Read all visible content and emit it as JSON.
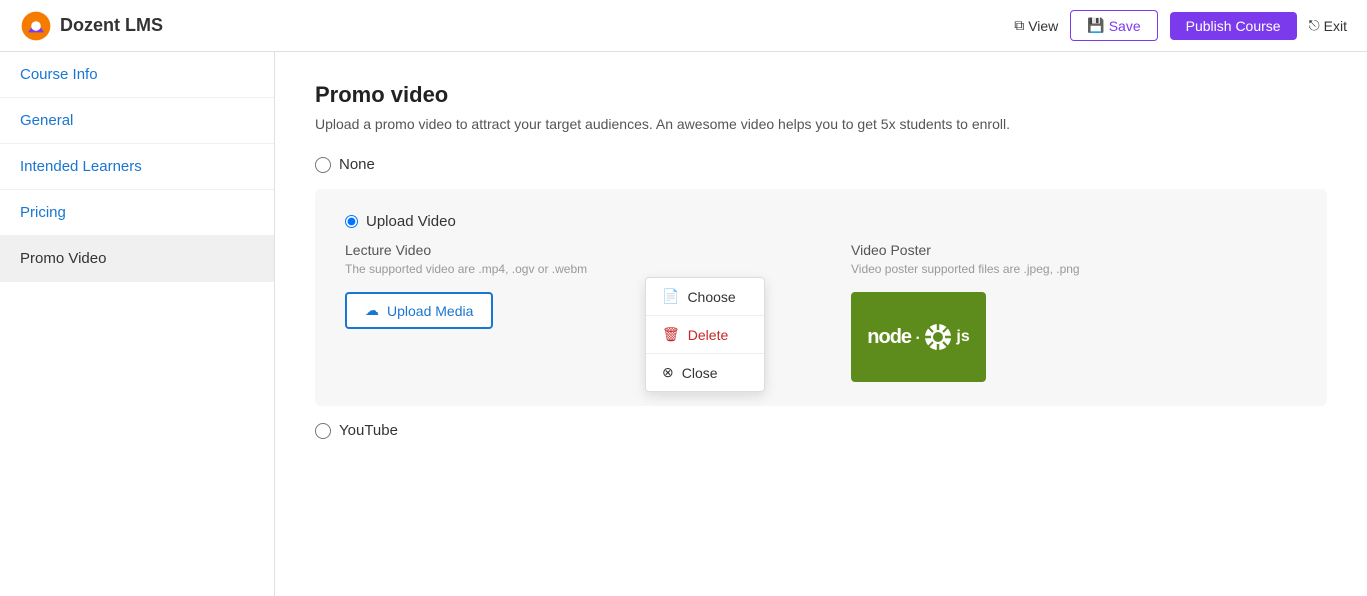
{
  "app": {
    "name": "Dozent LMS"
  },
  "header": {
    "view_label": "View",
    "save_label": "Save",
    "publish_label": "Publish Course",
    "exit_label": "Exit"
  },
  "sidebar": {
    "items": [
      {
        "label": "Course Info",
        "id": "course-info",
        "active": false
      },
      {
        "label": "General",
        "id": "general",
        "active": false
      },
      {
        "label": "Intended Learners",
        "id": "intended-learners",
        "active": false
      },
      {
        "label": "Pricing",
        "id": "pricing",
        "active": false
      },
      {
        "label": "Promo Video",
        "id": "promo-video",
        "active": true
      }
    ]
  },
  "main": {
    "title": "Promo video",
    "subtitle": "Upload a promo video to attract your target audiences. An awesome video helps you to get 5x students to enroll.",
    "options": {
      "none_label": "None",
      "upload_video_label": "Upload Video",
      "youtube_label": "YouTube"
    },
    "lecture_video": {
      "title": "Lecture Video",
      "subtitle": "The supported video are .mp4, .ogv or .webm",
      "upload_button_label": "Upload Media"
    },
    "video_poster": {
      "title": "Video Poster",
      "subtitle": "Video poster supported files are .jpeg, .png"
    },
    "dropdown": {
      "choose_label": "Choose",
      "delete_label": "Delete",
      "close_label": "Close"
    }
  }
}
